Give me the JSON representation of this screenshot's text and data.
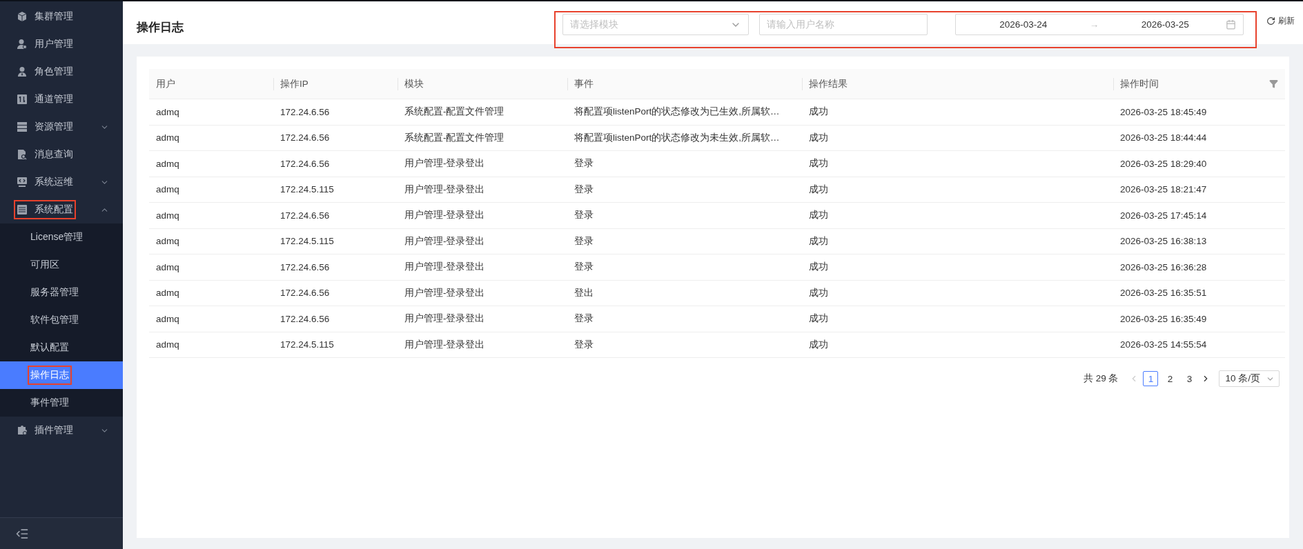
{
  "sidebar": {
    "items": [
      {
        "label": "集群管理",
        "selected": false,
        "highlighted": false
      },
      {
        "label": "用户管理",
        "selected": false,
        "highlighted": false
      },
      {
        "label": "角色管理",
        "selected": false,
        "highlighted": false
      },
      {
        "label": "通道管理",
        "selected": false,
        "highlighted": false
      },
      {
        "label": "资源管理",
        "selected": false,
        "highlighted": false,
        "expanded": false
      },
      {
        "label": "消息查询",
        "selected": false,
        "highlighted": false
      },
      {
        "label": "系统运维",
        "selected": false,
        "highlighted": false,
        "expanded": false
      },
      {
        "label": "系统配置",
        "selected": false,
        "highlighted": true,
        "expanded": true,
        "children": [
          {
            "label": "License管理",
            "selected": false,
            "highlighted": false
          },
          {
            "label": "可用区",
            "selected": false,
            "highlighted": false
          },
          {
            "label": "服务器管理",
            "selected": false,
            "highlighted": false
          },
          {
            "label": "软件包管理",
            "selected": false,
            "highlighted": false
          },
          {
            "label": "默认配置",
            "selected": false,
            "highlighted": false
          },
          {
            "label": "操作日志",
            "selected": true,
            "highlighted": true
          },
          {
            "label": "事件管理",
            "selected": false,
            "highlighted": false
          }
        ]
      },
      {
        "label": "插件管理",
        "selected": false,
        "highlighted": false,
        "expanded": false
      }
    ]
  },
  "page_title": "操作日志",
  "filters": {
    "highlighted": true,
    "module_select": {
      "placeholder": "请选择模块"
    },
    "user_input": {
      "placeholder": "请输入用户名称"
    },
    "date_range": {
      "start": "2026-03-24",
      "separator": "→",
      "end": "2026-03-25"
    },
    "refresh": "刷新"
  },
  "table": {
    "columns": [
      "用户",
      "操作IP",
      "模块",
      "事件",
      "操作结果",
      "操作时间"
    ],
    "rows": [
      [
        "admq",
        "172.24.6.56",
        "系统配置-配置文件管理",
        "将配置项listenPort的状态修改为已生效,所属软…",
        "成功",
        "2026-03-25 18:45:49"
      ],
      [
        "admq",
        "172.24.6.56",
        "系统配置-配置文件管理",
        "将配置项listenPort的状态修改为未生效,所属软…",
        "成功",
        "2026-03-25 18:44:44"
      ],
      [
        "admq",
        "172.24.6.56",
        "用户管理-登录登出",
        "登录",
        "成功",
        "2026-03-25 18:29:40"
      ],
      [
        "admq",
        "172.24.5.115",
        "用户管理-登录登出",
        "登录",
        "成功",
        "2026-03-25 18:21:47"
      ],
      [
        "admq",
        "172.24.6.56",
        "用户管理-登录登出",
        "登录",
        "成功",
        "2026-03-25 17:45:14"
      ],
      [
        "admq",
        "172.24.5.115",
        "用户管理-登录登出",
        "登录",
        "成功",
        "2026-03-25 16:38:13"
      ],
      [
        "admq",
        "172.24.6.56",
        "用户管理-登录登出",
        "登录",
        "成功",
        "2026-03-25 16:36:28"
      ],
      [
        "admq",
        "172.24.6.56",
        "用户管理-登录登出",
        "登出",
        "成功",
        "2026-03-25 16:35:51"
      ],
      [
        "admq",
        "172.24.6.56",
        "用户管理-登录登出",
        "登录",
        "成功",
        "2026-03-25 16:35:49"
      ],
      [
        "admq",
        "172.24.5.115",
        "用户管理-登录登出",
        "登录",
        "成功",
        "2026-03-25 14:55:54"
      ]
    ]
  },
  "pagination": {
    "total": "共 29 条",
    "pages": [
      {
        "label": "1",
        "selected": true
      },
      {
        "label": "2",
        "selected": false
      },
      {
        "label": "3",
        "selected": false
      }
    ],
    "page_size": "10 条/页"
  }
}
